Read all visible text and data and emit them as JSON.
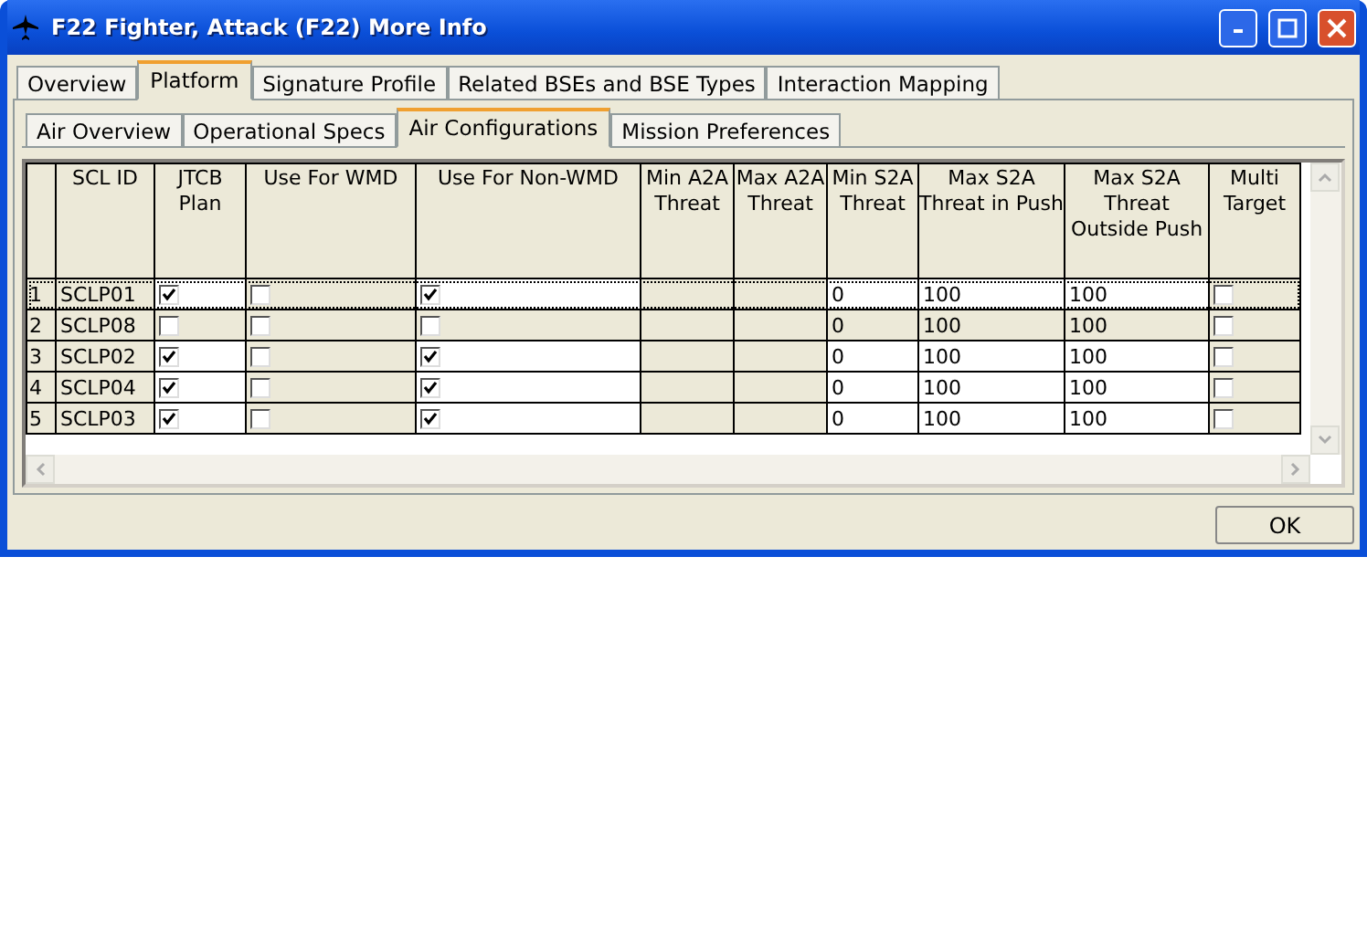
{
  "window": {
    "title": "F22 Fighter, Attack (F22) More Info"
  },
  "tabs": [
    {
      "label": "Overview",
      "selected": false
    },
    {
      "label": "Platform",
      "selected": true
    },
    {
      "label": "Signature Profile",
      "selected": false
    },
    {
      "label": "Related BSEs and BSE Types",
      "selected": false
    },
    {
      "label": "Interaction Mapping",
      "selected": false
    }
  ],
  "subtabs": [
    {
      "label": "Air Overview",
      "selected": false
    },
    {
      "label": "Operational Specs",
      "selected": false
    },
    {
      "label": "Air Configurations",
      "selected": true
    },
    {
      "label": "Mission Preferences",
      "selected": false
    }
  ],
  "table": {
    "columns": [
      {
        "label": "SCL ID",
        "kind": "text",
        "editable": false
      },
      {
        "label": "JTCB Plan",
        "kind": "check",
        "editable": true
      },
      {
        "label": "Use For WMD",
        "kind": "check",
        "editable": false
      },
      {
        "label": "Use For Non-WMD",
        "kind": "check",
        "editable": true
      },
      {
        "label": "Min A2A Threat",
        "kind": "text",
        "editable": false
      },
      {
        "label": "Max A2A Threat",
        "kind": "text",
        "editable": false
      },
      {
        "label": "Min S2A Threat",
        "kind": "text",
        "editable": true
      },
      {
        "label": "Max S2A Threat in Push",
        "kind": "text",
        "editable": true
      },
      {
        "label": "Max S2A Threat Outside Push",
        "kind": "text",
        "editable": true
      },
      {
        "label": "Multi Target",
        "kind": "check",
        "editable": false
      }
    ],
    "rows": [
      {
        "number": "1",
        "selected": true,
        "shaded": false,
        "cells": [
          {
            "text": "SCLP01"
          },
          {
            "checked": true
          },
          {
            "checked": false
          },
          {
            "checked": true
          },
          {
            "text": ""
          },
          {
            "text": ""
          },
          {
            "text": "0"
          },
          {
            "text": "100"
          },
          {
            "text": "100"
          },
          {
            "checked": false
          }
        ]
      },
      {
        "number": "2",
        "selected": false,
        "shaded": true,
        "cells": [
          {
            "text": "SCLP08"
          },
          {
            "checked": false
          },
          {
            "checked": false
          },
          {
            "checked": false
          },
          {
            "text": ""
          },
          {
            "text": ""
          },
          {
            "text": "0"
          },
          {
            "text": "100"
          },
          {
            "text": "100"
          },
          {
            "checked": false
          }
        ]
      },
      {
        "number": "3",
        "selected": false,
        "shaded": false,
        "cells": [
          {
            "text": "SCLP02"
          },
          {
            "checked": true
          },
          {
            "checked": false
          },
          {
            "checked": true
          },
          {
            "text": ""
          },
          {
            "text": ""
          },
          {
            "text": "0"
          },
          {
            "text": "100"
          },
          {
            "text": "100"
          },
          {
            "checked": false
          }
        ]
      },
      {
        "number": "4",
        "selected": false,
        "shaded": false,
        "cells": [
          {
            "text": "SCLP04"
          },
          {
            "checked": true
          },
          {
            "checked": false
          },
          {
            "checked": true
          },
          {
            "text": ""
          },
          {
            "text": ""
          },
          {
            "text": "0"
          },
          {
            "text": "100"
          },
          {
            "text": "100"
          },
          {
            "checked": false
          }
        ]
      },
      {
        "number": "5",
        "selected": false,
        "shaded": false,
        "cells": [
          {
            "text": "SCLP03"
          },
          {
            "checked": true
          },
          {
            "checked": false
          },
          {
            "checked": true
          },
          {
            "text": ""
          },
          {
            "text": ""
          },
          {
            "text": "0"
          },
          {
            "text": "100"
          },
          {
            "text": "100"
          },
          {
            "checked": false
          }
        ]
      }
    ]
  },
  "buttons": [
    {
      "label": "OK"
    }
  ]
}
